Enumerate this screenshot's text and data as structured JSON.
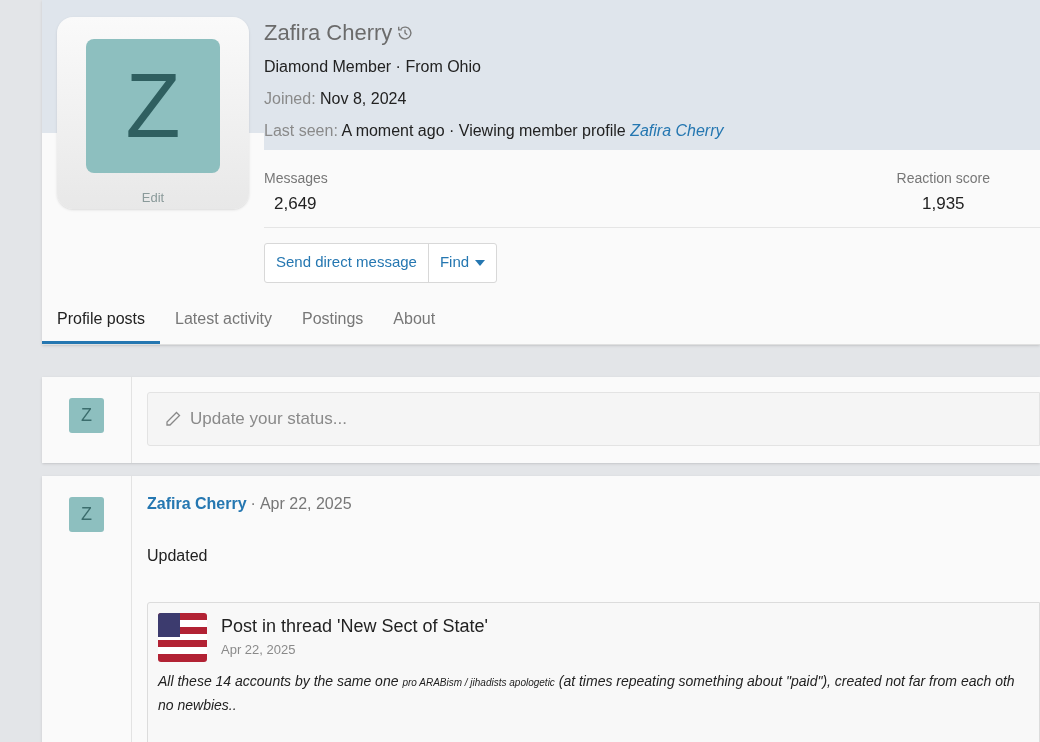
{
  "profile": {
    "name": "Zafira Cherry",
    "avatar_letter": "Z",
    "avatar_edit": "Edit",
    "title_line": "Diamond Member · From Ohio",
    "joined_label": "Joined:",
    "joined": "Nov 8, 2024",
    "last_seen_label": "Last seen:",
    "last_seen": "A moment ago · Viewing member profile",
    "last_seen_link": "Zafira Cherry",
    "stats": [
      {
        "label": "Messages",
        "value": "2,649"
      },
      {
        "label": "Reaction score",
        "value": "1,935"
      }
    ],
    "buttons": [
      {
        "label": "Send direct message",
        "dropdown": false
      },
      {
        "label": "Find",
        "dropdown": true
      }
    ]
  },
  "tabs": [
    {
      "label": "Profile posts",
      "selected": true
    },
    {
      "label": "Latest activity",
      "selected": false
    },
    {
      "label": "Postings",
      "selected": false
    },
    {
      "label": "About",
      "selected": false
    }
  ],
  "status_box": {
    "avatar_letter": "Z",
    "placeholder": "Update your status..."
  },
  "posts": [
    {
      "avatar_letter": "Z",
      "author": "Zafira Cherry",
      "separator": "·",
      "date": "Apr 22, 2025",
      "body": "Updated",
      "attachment": {
        "title": "Post in thread 'New Sect of State'",
        "date": "Apr 22, 2025",
        "text_start": "All these 14 accounts by the same one ",
        "text_small": "pro ARABism / jihadists apologetic",
        "text_end": " (at times repeating something about \"paid\"), created not far from each oth",
        "text_next_line": "no newbies.."
      }
    }
  ]
}
